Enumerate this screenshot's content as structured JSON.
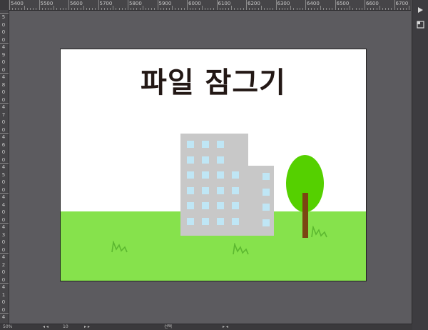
{
  "canvas": {
    "title": "파일 잠그기",
    "colors": {
      "background": "#ffffff",
      "grass": "#86e24c",
      "building": "#c8c8c8",
      "window": "#bfe6f5",
      "tree_crown": "#55d000",
      "tree_trunk": "#7b4512",
      "title_text": "#231815"
    }
  },
  "ruler": {
    "top_labels": [
      "5400",
      "5500",
      "5600",
      "5700",
      "5800",
      "5900",
      "6000",
      "6100",
      "6200",
      "6300",
      "6400",
      "6500",
      "6600",
      "6700"
    ],
    "left_labels": [
      "5",
      "0",
      "0",
      "0",
      "4",
      "9",
      "0",
      "0",
      "4",
      "8",
      "0",
      "0",
      "4",
      "7",
      "0",
      "0",
      "4",
      "6",
      "0",
      "0",
      "4",
      "5",
      "0",
      "0",
      "4",
      "4",
      "0",
      "0",
      "4",
      "3",
      "0",
      "0",
      "4",
      "2",
      "0",
      "0",
      "4",
      "1",
      "0",
      "0",
      "4"
    ]
  },
  "side_panel": {
    "play_icon": "play-icon",
    "layers_icon": "layers-icon"
  },
  "statusbar": {
    "zoom": "50%",
    "page": "10",
    "mode": "선택"
  }
}
